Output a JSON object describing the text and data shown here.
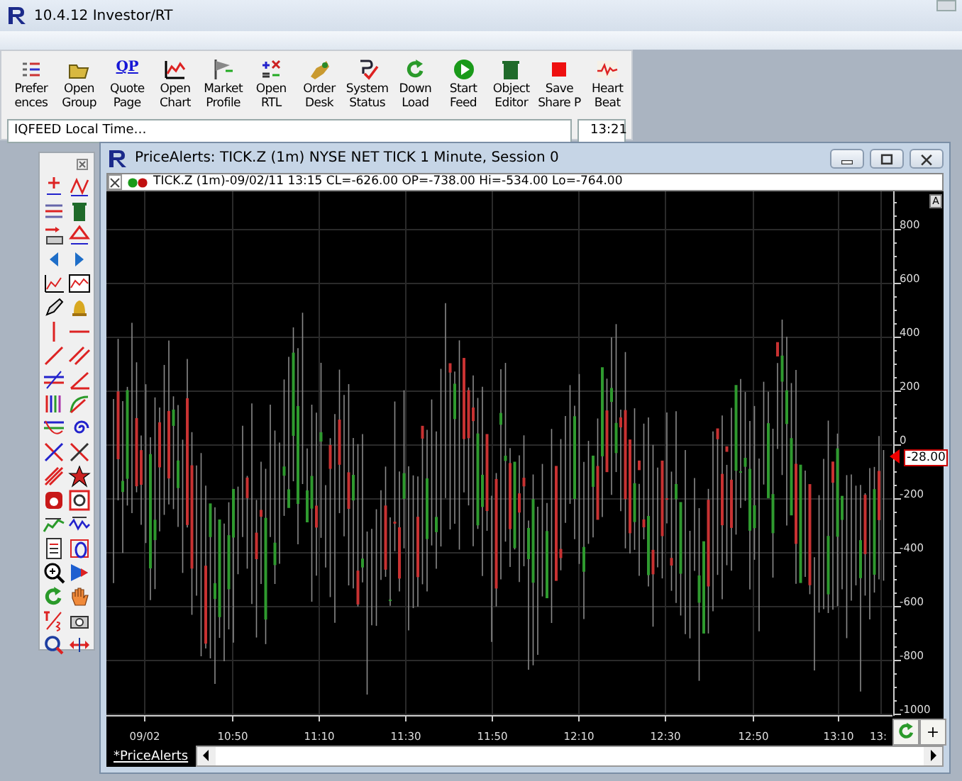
{
  "window": {
    "title": "10.4.12 Investor/RT"
  },
  "toolbar": {
    "buttons": [
      {
        "lines": [
          "Prefer",
          "ences"
        ]
      },
      {
        "lines": [
          "Open",
          "Group"
        ]
      },
      {
        "lines": [
          "Quote",
          "Page"
        ],
        "glyph": "QP"
      },
      {
        "lines": [
          "Open",
          "Chart"
        ]
      },
      {
        "lines": [
          "Market",
          "Profile"
        ]
      },
      {
        "lines": [
          "Open",
          "RTL"
        ]
      },
      {
        "lines": [
          "Order",
          "Desk"
        ]
      },
      {
        "lines": [
          "System",
          "Status"
        ]
      },
      {
        "lines": [
          "Down",
          "Load"
        ]
      },
      {
        "lines": [
          "Start",
          "Feed"
        ]
      },
      {
        "lines": [
          "Object",
          "Editor"
        ]
      },
      {
        "lines": [
          "Save",
          "Share P"
        ]
      },
      {
        "lines": [
          "Heart",
          "Beat"
        ]
      }
    ],
    "status": {
      "text": "IQFEED Local Time…",
      "time": "13:21"
    }
  },
  "chart_window": {
    "title": "PriceAlerts: TICK.Z (1m) NYSE NET TICK 1 Minute, Session 0",
    "legend": "TICK.Z (1m)-09/02/11 13:15 CL=-626.00 OP=-738.00 Hi=-534.00 Lo=-764.00",
    "scale_button": "A",
    "y_labels": [
      "800",
      "600",
      "400",
      "200",
      "0",
      "-200",
      "-400",
      "-600",
      "-800",
      "-1000"
    ],
    "x_labels": [
      "09/02",
      "10:50",
      "11:10",
      "11:30",
      "11:50",
      "12:10",
      "12:30",
      "12:50",
      "13:10",
      "13:"
    ],
    "last_price": "-28.00",
    "zoom_button": "+",
    "tab": {
      "label": "*PriceAlerts",
      "selected": true
    }
  }
}
